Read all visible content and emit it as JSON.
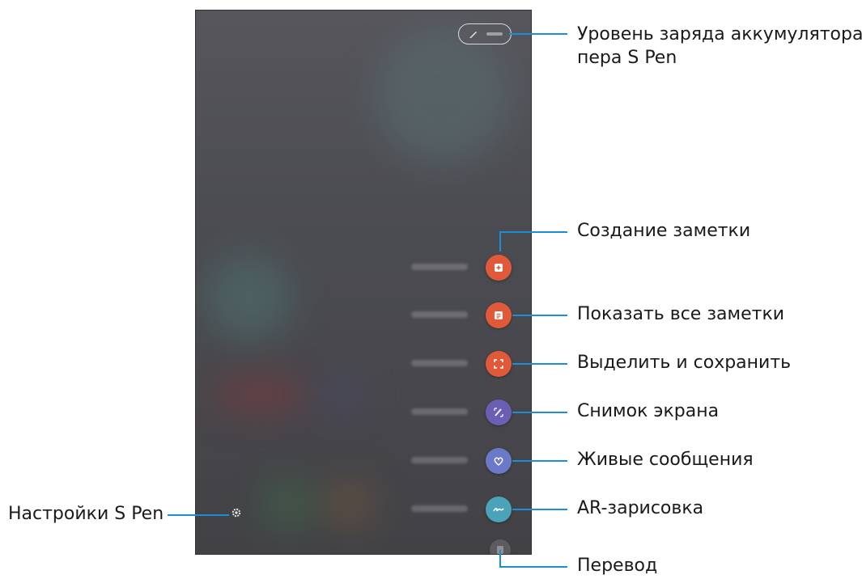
{
  "labels": {
    "battery_line1": "Уровень заряда аккумулятора",
    "battery_line2": "пера S Pen",
    "create_note": "Создание заметки",
    "view_all_notes": "Показать все заметки",
    "smart_select": "Выделить и сохранить",
    "screen_write": "Снимок экрана",
    "live_message": "Живые сообщения",
    "ar_doodle": "AR-зарисовка",
    "translate": "Перевод",
    "settings": "Настройки S Pen"
  },
  "colors": {
    "create_note": "#e05a3a",
    "view_all_notes": "#e05a3a",
    "smart_select": "#e05a3a",
    "screen_write": "#6b5fb5",
    "live_message": "#6a7ac8",
    "ar_doodle": "#4aa3b8",
    "translate": "#707076",
    "callout_line": "#1a8fd6"
  },
  "icons": {
    "battery": "pen-battery-icon",
    "create_note": "create-note-icon",
    "view_all_notes": "notes-list-icon",
    "smart_select": "smart-select-icon",
    "screen_write": "screen-write-icon",
    "live_message": "heart-icon",
    "ar_doodle": "ar-doodle-icon",
    "translate": "translate-icon",
    "settings": "gear-icon"
  }
}
